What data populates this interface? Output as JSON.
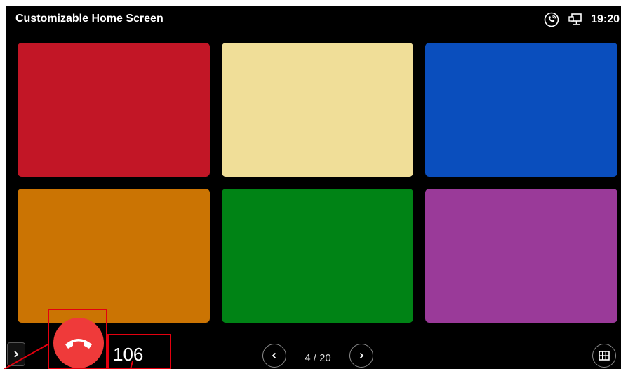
{
  "status_bar": {
    "title": "Customizable Home Screen",
    "time": "19:20",
    "icons": [
      "phone-call-icon",
      "network-icon"
    ]
  },
  "tiles": [
    {
      "color": "#c21626"
    },
    {
      "color": "#f0de98"
    },
    {
      "color": "#0a4ebd"
    },
    {
      "color": "#cb7403"
    },
    {
      "color": "#008315"
    },
    {
      "color": "#9a3a99"
    }
  ],
  "pagination": {
    "current": 4,
    "total": 20,
    "label": "4 / 20"
  },
  "call": {
    "extension": "106",
    "hangup_color": "#ef3a3a"
  },
  "annotation_color": "#e3000f"
}
